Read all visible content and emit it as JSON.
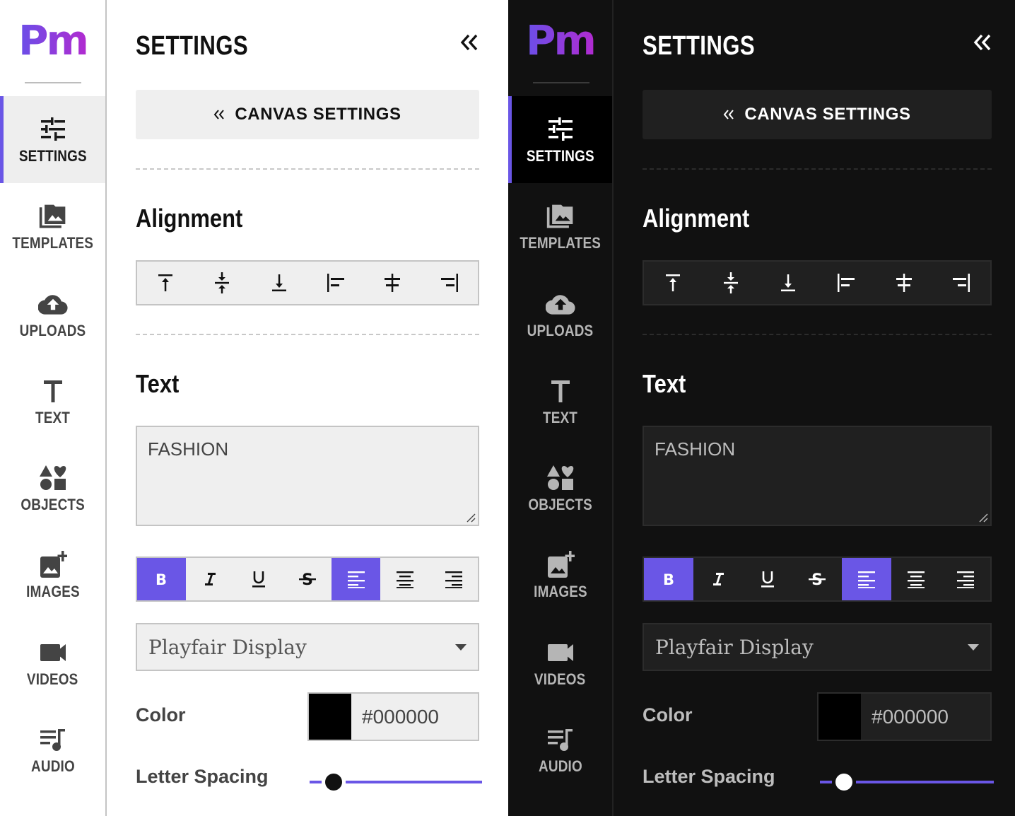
{
  "brand": {
    "logo_text": "Pm",
    "gradient_start": "#6a4fe8",
    "gradient_end": "#b12bd0"
  },
  "accent_color": "#6a56e6",
  "themes": [
    {
      "name": "light"
    },
    {
      "name": "dark"
    }
  ],
  "rail": {
    "items": [
      {
        "label": "SETTINGS",
        "icon": "sliders-icon",
        "active": true
      },
      {
        "label": "TEMPLATES",
        "icon": "photo-library-icon",
        "active": false
      },
      {
        "label": "UPLOADS",
        "icon": "cloud-upload-icon",
        "active": false
      },
      {
        "label": "TEXT",
        "icon": "text-icon",
        "active": false
      },
      {
        "label": "OBJECTS",
        "icon": "shapes-icon",
        "active": false
      },
      {
        "label": "IMAGES",
        "icon": "add-photo-icon",
        "active": false
      },
      {
        "label": "VIDEOS",
        "icon": "videocam-icon",
        "active": false
      },
      {
        "label": "AUDIO",
        "icon": "queue-music-icon",
        "active": false
      }
    ]
  },
  "panel": {
    "title": "SETTINGS",
    "collapse_icon": "double-chevron-left-icon",
    "canvas_settings_button": {
      "label": "CANVAS SETTINGS",
      "icon": "double-chevron-left-icon"
    },
    "alignment": {
      "title": "Alignment",
      "buttons": [
        {
          "name": "align-top",
          "icon": "align-top-icon"
        },
        {
          "name": "align-middle",
          "icon": "align-vertical-center-icon"
        },
        {
          "name": "align-bottom",
          "icon": "align-bottom-icon"
        },
        {
          "name": "align-left",
          "icon": "align-left-icon"
        },
        {
          "name": "align-center",
          "icon": "align-horizontal-center-icon"
        },
        {
          "name": "align-right",
          "icon": "align-right-icon"
        }
      ]
    },
    "text": {
      "title": "Text",
      "value": "FASHION",
      "format_buttons": [
        {
          "name": "bold",
          "icon": "bold-icon",
          "active": true
        },
        {
          "name": "italic",
          "icon": "italic-icon",
          "active": false
        },
        {
          "name": "underline",
          "icon": "underline-icon",
          "active": false
        },
        {
          "name": "strikethrough",
          "icon": "strikethrough-icon",
          "active": false
        },
        {
          "name": "text-align-left",
          "icon": "text-align-left-icon",
          "active": true
        },
        {
          "name": "text-align-center",
          "icon": "text-align-center-icon",
          "active": false
        },
        {
          "name": "text-align-right",
          "icon": "text-align-right-icon",
          "active": false
        }
      ],
      "font_family": "Playfair Display",
      "color_label": "Color",
      "color_value": "#000000",
      "letter_spacing_label": "Letter Spacing",
      "letter_spacing_fraction": 0.14
    }
  }
}
